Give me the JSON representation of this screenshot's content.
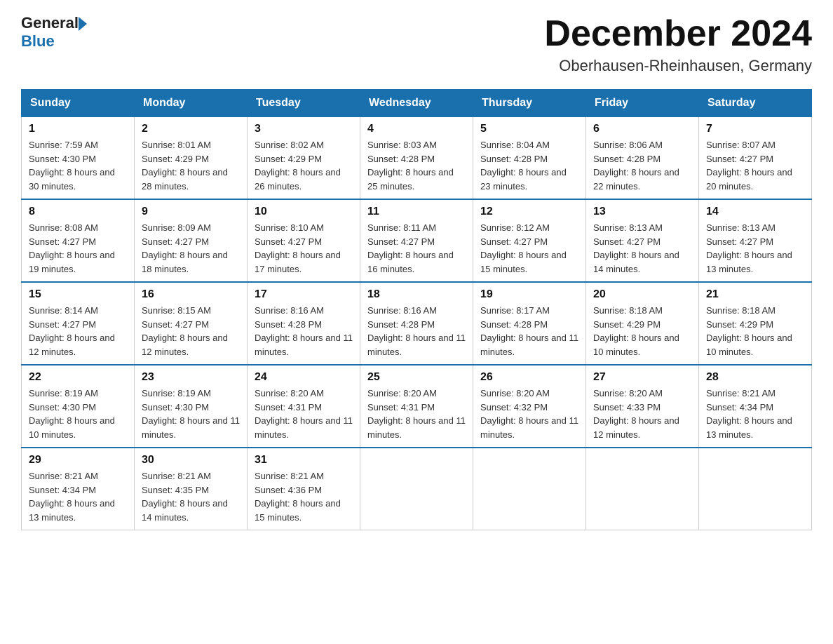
{
  "header": {
    "logo_general": "General",
    "logo_blue": "Blue",
    "month_title": "December 2024",
    "location": "Oberhausen-Rheinhausen, Germany"
  },
  "days_of_week": [
    "Sunday",
    "Monday",
    "Tuesday",
    "Wednesday",
    "Thursday",
    "Friday",
    "Saturday"
  ],
  "weeks": [
    [
      {
        "day": "1",
        "sunrise": "Sunrise: 7:59 AM",
        "sunset": "Sunset: 4:30 PM",
        "daylight": "Daylight: 8 hours and 30 minutes."
      },
      {
        "day": "2",
        "sunrise": "Sunrise: 8:01 AM",
        "sunset": "Sunset: 4:29 PM",
        "daylight": "Daylight: 8 hours and 28 minutes."
      },
      {
        "day": "3",
        "sunrise": "Sunrise: 8:02 AM",
        "sunset": "Sunset: 4:29 PM",
        "daylight": "Daylight: 8 hours and 26 minutes."
      },
      {
        "day": "4",
        "sunrise": "Sunrise: 8:03 AM",
        "sunset": "Sunset: 4:28 PM",
        "daylight": "Daylight: 8 hours and 25 minutes."
      },
      {
        "day": "5",
        "sunrise": "Sunrise: 8:04 AM",
        "sunset": "Sunset: 4:28 PM",
        "daylight": "Daylight: 8 hours and 23 minutes."
      },
      {
        "day": "6",
        "sunrise": "Sunrise: 8:06 AM",
        "sunset": "Sunset: 4:28 PM",
        "daylight": "Daylight: 8 hours and 22 minutes."
      },
      {
        "day": "7",
        "sunrise": "Sunrise: 8:07 AM",
        "sunset": "Sunset: 4:27 PM",
        "daylight": "Daylight: 8 hours and 20 minutes."
      }
    ],
    [
      {
        "day": "8",
        "sunrise": "Sunrise: 8:08 AM",
        "sunset": "Sunset: 4:27 PM",
        "daylight": "Daylight: 8 hours and 19 minutes."
      },
      {
        "day": "9",
        "sunrise": "Sunrise: 8:09 AM",
        "sunset": "Sunset: 4:27 PM",
        "daylight": "Daylight: 8 hours and 18 minutes."
      },
      {
        "day": "10",
        "sunrise": "Sunrise: 8:10 AM",
        "sunset": "Sunset: 4:27 PM",
        "daylight": "Daylight: 8 hours and 17 minutes."
      },
      {
        "day": "11",
        "sunrise": "Sunrise: 8:11 AM",
        "sunset": "Sunset: 4:27 PM",
        "daylight": "Daylight: 8 hours and 16 minutes."
      },
      {
        "day": "12",
        "sunrise": "Sunrise: 8:12 AM",
        "sunset": "Sunset: 4:27 PM",
        "daylight": "Daylight: 8 hours and 15 minutes."
      },
      {
        "day": "13",
        "sunrise": "Sunrise: 8:13 AM",
        "sunset": "Sunset: 4:27 PM",
        "daylight": "Daylight: 8 hours and 14 minutes."
      },
      {
        "day": "14",
        "sunrise": "Sunrise: 8:13 AM",
        "sunset": "Sunset: 4:27 PM",
        "daylight": "Daylight: 8 hours and 13 minutes."
      }
    ],
    [
      {
        "day": "15",
        "sunrise": "Sunrise: 8:14 AM",
        "sunset": "Sunset: 4:27 PM",
        "daylight": "Daylight: 8 hours and 12 minutes."
      },
      {
        "day": "16",
        "sunrise": "Sunrise: 8:15 AM",
        "sunset": "Sunset: 4:27 PM",
        "daylight": "Daylight: 8 hours and 12 minutes."
      },
      {
        "day": "17",
        "sunrise": "Sunrise: 8:16 AM",
        "sunset": "Sunset: 4:28 PM",
        "daylight": "Daylight: 8 hours and 11 minutes."
      },
      {
        "day": "18",
        "sunrise": "Sunrise: 8:16 AM",
        "sunset": "Sunset: 4:28 PM",
        "daylight": "Daylight: 8 hours and 11 minutes."
      },
      {
        "day": "19",
        "sunrise": "Sunrise: 8:17 AM",
        "sunset": "Sunset: 4:28 PM",
        "daylight": "Daylight: 8 hours and 11 minutes."
      },
      {
        "day": "20",
        "sunrise": "Sunrise: 8:18 AM",
        "sunset": "Sunset: 4:29 PM",
        "daylight": "Daylight: 8 hours and 10 minutes."
      },
      {
        "day": "21",
        "sunrise": "Sunrise: 8:18 AM",
        "sunset": "Sunset: 4:29 PM",
        "daylight": "Daylight: 8 hours and 10 minutes."
      }
    ],
    [
      {
        "day": "22",
        "sunrise": "Sunrise: 8:19 AM",
        "sunset": "Sunset: 4:30 PM",
        "daylight": "Daylight: 8 hours and 10 minutes."
      },
      {
        "day": "23",
        "sunrise": "Sunrise: 8:19 AM",
        "sunset": "Sunset: 4:30 PM",
        "daylight": "Daylight: 8 hours and 11 minutes."
      },
      {
        "day": "24",
        "sunrise": "Sunrise: 8:20 AM",
        "sunset": "Sunset: 4:31 PM",
        "daylight": "Daylight: 8 hours and 11 minutes."
      },
      {
        "day": "25",
        "sunrise": "Sunrise: 8:20 AM",
        "sunset": "Sunset: 4:31 PM",
        "daylight": "Daylight: 8 hours and 11 minutes."
      },
      {
        "day": "26",
        "sunrise": "Sunrise: 8:20 AM",
        "sunset": "Sunset: 4:32 PM",
        "daylight": "Daylight: 8 hours and 11 minutes."
      },
      {
        "day": "27",
        "sunrise": "Sunrise: 8:20 AM",
        "sunset": "Sunset: 4:33 PM",
        "daylight": "Daylight: 8 hours and 12 minutes."
      },
      {
        "day": "28",
        "sunrise": "Sunrise: 8:21 AM",
        "sunset": "Sunset: 4:34 PM",
        "daylight": "Daylight: 8 hours and 13 minutes."
      }
    ],
    [
      {
        "day": "29",
        "sunrise": "Sunrise: 8:21 AM",
        "sunset": "Sunset: 4:34 PM",
        "daylight": "Daylight: 8 hours and 13 minutes."
      },
      {
        "day": "30",
        "sunrise": "Sunrise: 8:21 AM",
        "sunset": "Sunset: 4:35 PM",
        "daylight": "Daylight: 8 hours and 14 minutes."
      },
      {
        "day": "31",
        "sunrise": "Sunrise: 8:21 AM",
        "sunset": "Sunset: 4:36 PM",
        "daylight": "Daylight: 8 hours and 15 minutes."
      },
      null,
      null,
      null,
      null
    ]
  ]
}
